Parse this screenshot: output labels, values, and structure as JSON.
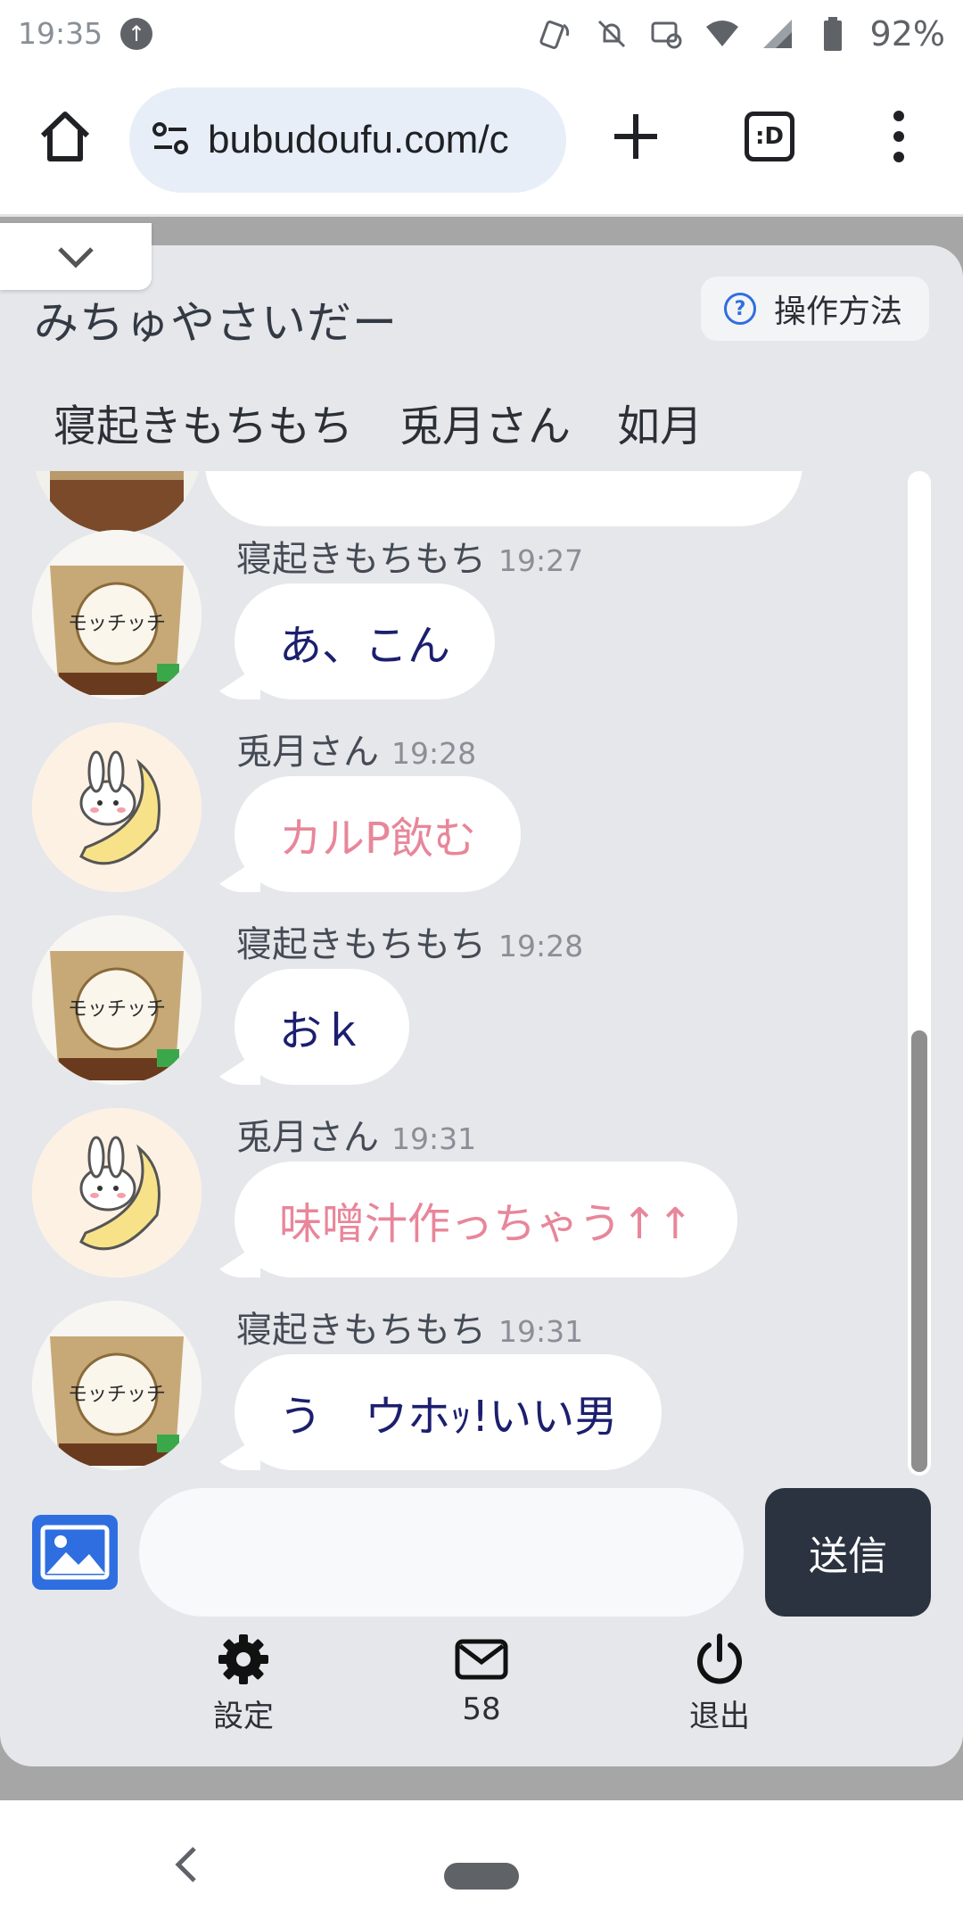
{
  "status_bar": {
    "time": "19:35",
    "battery": "92%",
    "icons": [
      "upload-arrow-icon",
      "nfc-icon",
      "notifications-off-icon",
      "cast-off-icon",
      "wifi-icon",
      "signal-icon",
      "battery-icon"
    ]
  },
  "browser": {
    "url": "bubudoufu.com/c",
    "tabs_label": ":D",
    "icons": [
      "home-icon",
      "site-settings-icon",
      "new-tab-plus-icon",
      "tabs-icon",
      "overflow-menu-icon"
    ]
  },
  "room": {
    "title": "みちゅやさいだー",
    "help_label": "操作方法",
    "members": [
      "寝起きもちもち",
      "兎月さん",
      "如月"
    ]
  },
  "messages": [
    {
      "sender": "寝起きもちもち",
      "time": "19:27",
      "text": "あ、こん",
      "color": "#1c1f6e",
      "avatar": "cup-noodle-avatar"
    },
    {
      "sender": "兎月さん",
      "time": "19:28",
      "text": "カルP飲む",
      "color": "#e8869a",
      "avatar": "bunny-moon-avatar"
    },
    {
      "sender": "寝起きもちもち",
      "time": "19:28",
      "text": "おｋ",
      "color": "#1c1f6e",
      "avatar": "cup-noodle-avatar"
    },
    {
      "sender": "兎月さん",
      "time": "19:31",
      "text": "味噌汁作っちゃう↑↑",
      "color": "#e8869a",
      "avatar": "bunny-moon-avatar"
    },
    {
      "sender": "寝起きもちもち",
      "time": "19:31",
      "text": "う　ウホｯ!いい男",
      "color": "#1c1f6e",
      "avatar": "cup-noodle-avatar"
    }
  ],
  "composer": {
    "placeholder": "",
    "send_label": "送信",
    "image_icon": "image-upload-icon"
  },
  "footer": {
    "settings_label": "設定",
    "mail_count": "58",
    "logout_label": "退出"
  },
  "colors": {
    "panel_bg": "#e6e7eb",
    "send_button": "#2b3340",
    "accent_blue": "#2f6ee0",
    "pink_text": "#e8869a",
    "navy_text": "#1c1f6e"
  }
}
